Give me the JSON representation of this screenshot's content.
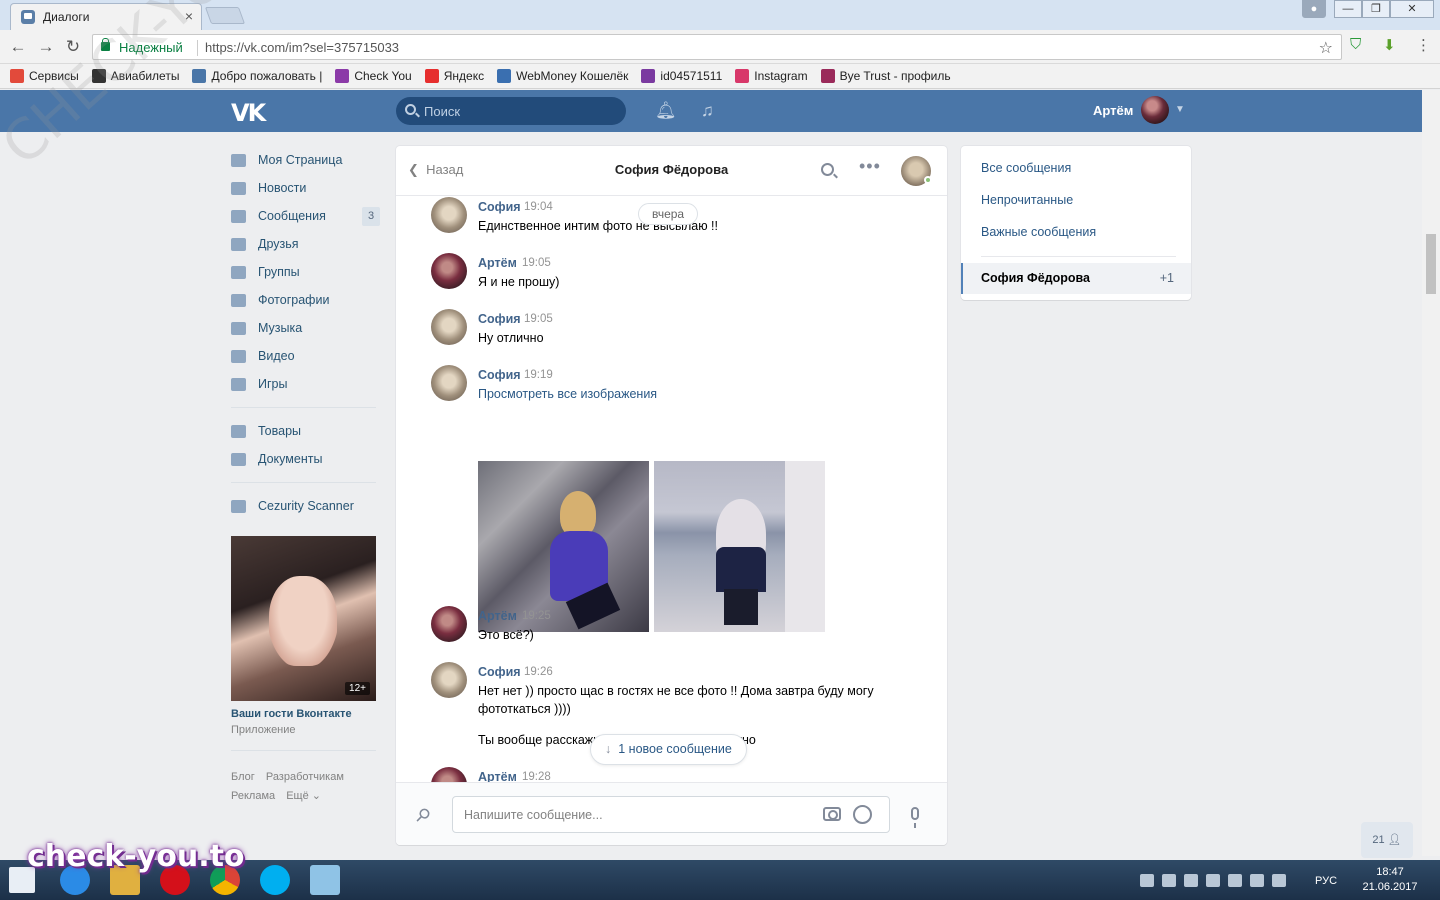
{
  "browser": {
    "tab_title": "Диалоги",
    "tab_close": "×",
    "secure_label": "Надежный",
    "url": "https://vk.com/im?sel=375715033",
    "bookmarks": [
      {
        "label": "Сервисы",
        "color": "#e24a3b"
      },
      {
        "label": "Авиабилеты",
        "color": "#333333"
      },
      {
        "label": "Добро пожаловать |",
        "color": "#4a76a8"
      },
      {
        "label": "Check You",
        "color": "#8b3aa8"
      },
      {
        "label": "Яндекс",
        "color": "#e62e2e"
      },
      {
        "label": "WebMoney Кошелёк",
        "color": "#3a6fb0"
      },
      {
        "label": "id04571511",
        "color": "#7a3aa0"
      },
      {
        "label": "Instagram",
        "color": "#d8386a"
      },
      {
        "label": "Bye Trust - профиль",
        "color": "#9a2a5a"
      }
    ]
  },
  "header": {
    "search_placeholder": "Поиск",
    "user_name": "Артём"
  },
  "nav": {
    "items": [
      {
        "label": "Моя Страница"
      },
      {
        "label": "Новости"
      },
      {
        "label": "Сообщения",
        "count": "3"
      },
      {
        "label": "Друзья"
      },
      {
        "label": "Группы"
      },
      {
        "label": "Фотографии"
      },
      {
        "label": "Музыка"
      },
      {
        "label": "Видео"
      },
      {
        "label": "Игры"
      }
    ],
    "items2": [
      {
        "label": "Товары"
      },
      {
        "label": "Документы"
      }
    ],
    "items3": [
      {
        "label": "Cezurity Scanner"
      }
    ],
    "ad_age": "12+",
    "ad_title": "Ваши гости Вконтакте",
    "ad_subtitle": "Приложение",
    "footer": [
      "Блог",
      "Разработчикам",
      "Реклама",
      "Ещё ⌄"
    ]
  },
  "chat": {
    "back_label": "Назад",
    "title": "София Фёдорова",
    "day_flag": "вчера",
    "messages": [
      {
        "author": "София",
        "time": "19:04",
        "text": "Единственное интим фото не высылаю !!"
      },
      {
        "author": "Артём",
        "time": "19:05",
        "text": "Я и не прошу)"
      },
      {
        "author": "София",
        "time": "19:05",
        "text": "Ну отлично"
      },
      {
        "author": "София",
        "time": "19:19",
        "text": "Просмотреть все изображения"
      },
      {
        "author": "Артём",
        "time": "19:25",
        "text": "Это всё?)"
      },
      {
        "author": "София",
        "time": "19:26",
        "text": "Нет нет )) просто щас в гостях не все фото !! Дома завтра буду могу фототкаться ))))",
        "text2": "Ты вообще расскажи про себя , если не сложно"
      },
      {
        "author": "Артём",
        "time": "19:28",
        "text": ""
      }
    ],
    "new_message_label": "1 новое сообщение",
    "composer_placeholder": "Напишите сообщение..."
  },
  "filters": {
    "all": "Все сообщения",
    "unread": "Непрочитанные",
    "important": "Важные сообщения",
    "active_name": "София Фёдорова",
    "active_count": "+1"
  },
  "online_count": "21",
  "taskbar": {
    "lang": "РУС",
    "time": "18:47",
    "date": "21.06.2017"
  },
  "watermarks": {
    "diagonal": "CHECK-YOU.ME",
    "brand": "check-you.to"
  },
  "colors": {
    "vk_blue": "#4a76a8",
    "link": "#2a5885",
    "author": "#42648b"
  }
}
